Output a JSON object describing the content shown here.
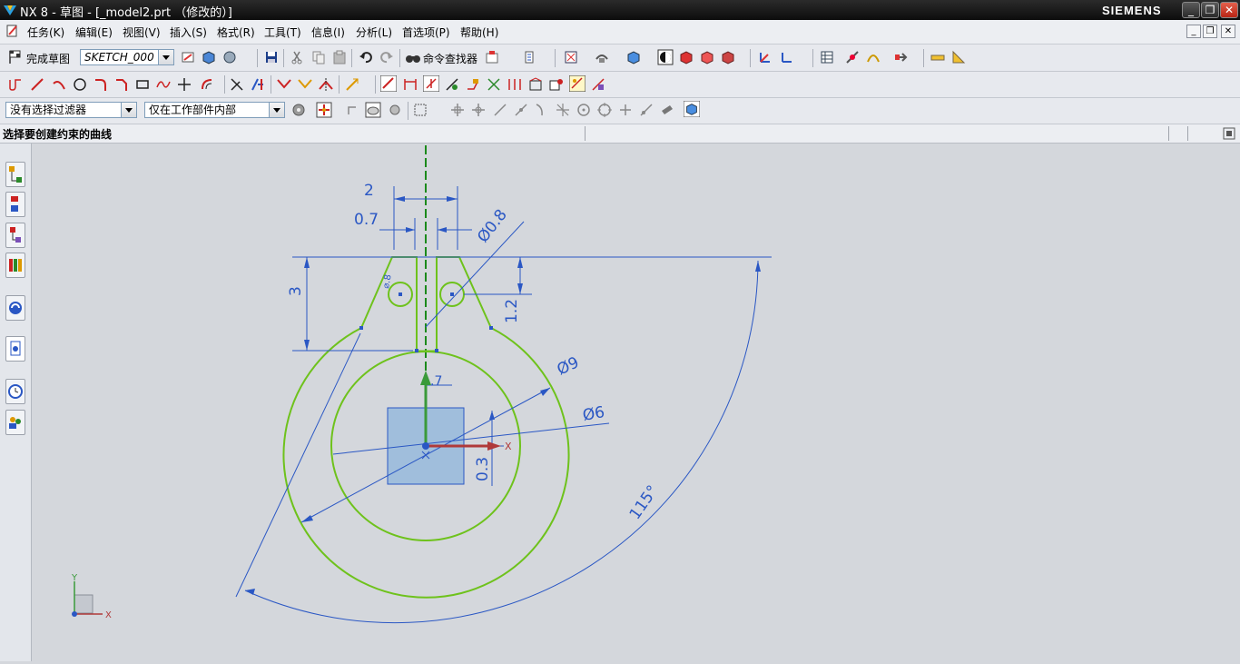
{
  "window": {
    "title": "NX 8 - 草图 - [_model2.prt （修改的）]",
    "brand": "SIEMENS"
  },
  "menu": {
    "items": [
      "任务(K)",
      "编辑(E)",
      "视图(V)",
      "插入(S)",
      "格式(R)",
      "工具(T)",
      "信息(I)",
      "分析(L)",
      "首选项(P)",
      "帮助(H)"
    ]
  },
  "sketch_toolbar": {
    "finish_label": "完成草图",
    "sketch_name": "SKETCH_000",
    "command_finder_label": "命令查找器"
  },
  "selection_bar": {
    "filter": "没有选择过滤器",
    "scope": "仅在工作部件内部"
  },
  "status": {
    "prompt": "选择要创建约束的曲线"
  },
  "colors": {
    "curve": "#6ec21c",
    "dimension": "#2a57c4",
    "centerline": "#1b8a1b",
    "datum_z": "#3a9a3a",
    "datum_x": "#b03a3a",
    "block": "#8fb6dc"
  },
  "sketch": {
    "dimensions": {
      "width_top": "2",
      "slot_width": "0.7",
      "hole_dia": "Ø0.8",
      "height": "3",
      "hole_offset": "1.2",
      "outer_dia": "Ø9",
      "inner_dia": "Ø6",
      "neck_width": ".7",
      "center_offset": "0.3",
      "angle": "115°"
    },
    "axis_x_label": "X",
    "triad_x": "X",
    "triad_y": "Y",
    "triad_z": "Y"
  },
  "icons": [
    "nx-logo-icon",
    "finish-sketch-icon",
    "save-icon",
    "cut-icon",
    "copy-icon",
    "paste-icon",
    "undo-icon",
    "redo-icon",
    "binoculars-icon",
    "profile-icon",
    "line-icon",
    "arc-icon",
    "circle-icon",
    "fillet-icon",
    "chamfer-icon",
    "rectangle-icon",
    "polygon-icon",
    "point-icon",
    "trim-icon",
    "extend-icon",
    "constraint-icon",
    "dimension-icon",
    "snap-icon",
    "view-icon",
    "shade-icon"
  ]
}
